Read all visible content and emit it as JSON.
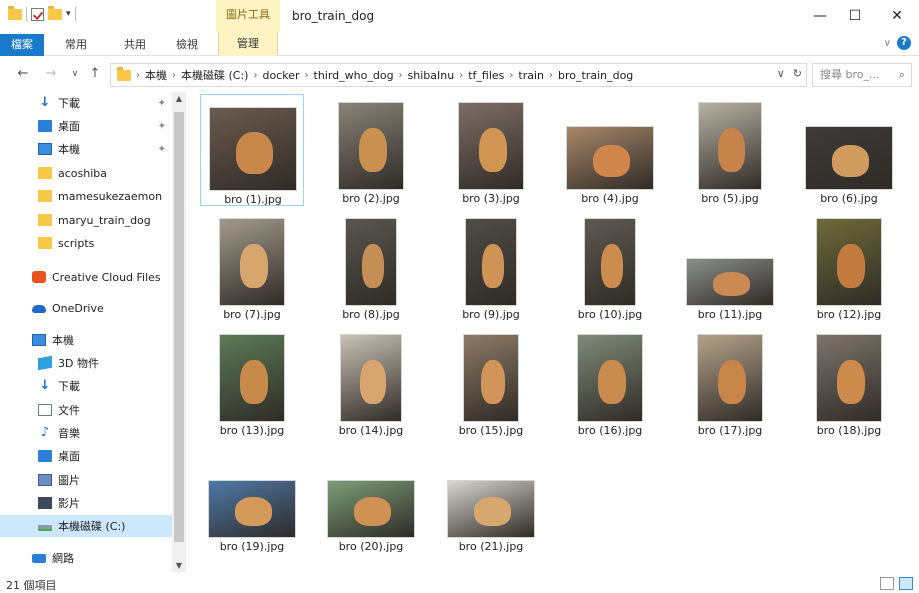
{
  "window": {
    "title": "bro_train_dog",
    "context_tab_group": "圖片工具",
    "minimize": "—",
    "maximize": "☐",
    "close": "✕"
  },
  "ribbon": {
    "tabs": [
      {
        "label": "檔案"
      },
      {
        "label": "常用"
      },
      {
        "label": "共用"
      },
      {
        "label": "檢視"
      },
      {
        "label": "管理"
      }
    ]
  },
  "nav": {
    "back": "←",
    "forward": "→",
    "up": "↑",
    "breadcrumbs": [
      "本機",
      "本機磁碟 (C:)",
      "docker",
      "third_who_dog",
      "shibaInu",
      "tf_files",
      "train",
      "bro_train_dog"
    ],
    "search_placeholder": "搜尋 bro_...",
    "refresh": "↻",
    "dropdown": "∨"
  },
  "sidebar": {
    "items": [
      {
        "label": "下載",
        "icon": "download-icon",
        "pinned": true
      },
      {
        "label": "桌面",
        "icon": "desktop-icon",
        "pinned": true
      },
      {
        "label": "本機",
        "icon": "pc-icon",
        "pinned": true
      },
      {
        "label": "acoshiba",
        "icon": "folder-icon"
      },
      {
        "label": "mamesukezaemon",
        "icon": "folder-icon"
      },
      {
        "label": "maryu_train_dog",
        "icon": "folder-icon"
      },
      {
        "label": "scripts",
        "icon": "folder-icon"
      },
      {
        "label": "Creative Cloud Files",
        "icon": "creative-cloud-icon"
      },
      {
        "label": "OneDrive",
        "icon": "onedrive-icon"
      },
      {
        "label": "本機",
        "icon": "pc-icon"
      },
      {
        "label": "3D 物件",
        "icon": "3d-objects-icon"
      },
      {
        "label": "下載",
        "icon": "download-icon"
      },
      {
        "label": "文件",
        "icon": "documents-icon"
      },
      {
        "label": "音樂",
        "icon": "music-icon"
      },
      {
        "label": "桌面",
        "icon": "desktop-icon"
      },
      {
        "label": "圖片",
        "icon": "pictures-icon"
      },
      {
        "label": "影片",
        "icon": "videos-icon"
      },
      {
        "label": "本機磁碟 (C:)",
        "icon": "drive-icon"
      },
      {
        "label": "網路",
        "icon": "network-icon"
      }
    ]
  },
  "files": [
    {
      "name": "bro (1).jpg",
      "bg": "#6b5a4f",
      "dog": "#c8874a"
    },
    {
      "name": "bro (2).jpg",
      "bg": "#8a8378",
      "dog": "#c9914f"
    },
    {
      "name": "bro (3).jpg",
      "bg": "#7d6e66",
      "dog": "#d19552"
    },
    {
      "name": "bro (4).jpg",
      "bg": "#a7886a",
      "dog": "#d0864a"
    },
    {
      "name": "bro (5).jpg",
      "bg": "#b8b2a4",
      "dog": "#c7834c"
    },
    {
      "name": "bro (6).jpg",
      "bg": "#3c3b38",
      "dog": "#d19a5f"
    },
    {
      "name": "bro (7).jpg",
      "bg": "#a29a8c",
      "dog": "#d6a66c"
    },
    {
      "name": "bro (8).jpg",
      "bg": "#58574f",
      "dog": "#c58e55"
    },
    {
      "name": "bro (9).jpg",
      "bg": "#4f4c46",
      "dog": "#cf9356"
    },
    {
      "name": "bro (10).jpg",
      "bg": "#5e5a52",
      "dog": "#ca8c4f"
    },
    {
      "name": "bro (11).jpg",
      "bg": "#8b8f8a",
      "dog": "#c98a54"
    },
    {
      "name": "bro (12).jpg",
      "bg": "#6d6a3a",
      "dog": "#c27c3f"
    },
    {
      "name": "bro (13).jpg",
      "bg": "#5d7a58",
      "dog": "#c88a4a"
    },
    {
      "name": "bro (14).jpg",
      "bg": "#c9c2b7",
      "dog": "#d8a470"
    },
    {
      "name": "bro (15).jpg",
      "bg": "#8c7a66",
      "dog": "#d19459"
    },
    {
      "name": "bro (16).jpg",
      "bg": "#7f8b79",
      "dog": "#c98b4e"
    },
    {
      "name": "bro (17).jpg",
      "bg": "#b4a38c",
      "dog": "#c7854a"
    },
    {
      "name": "bro (18).jpg",
      "bg": "#7d756c",
      "dog": "#cc8a4b"
    },
    {
      "name": "bro (19).jpg",
      "bg": "#4f79a8",
      "dog": "#d39a5c"
    },
    {
      "name": "bro (20).jpg",
      "bg": "#7d9d78",
      "dog": "#cf9154"
    },
    {
      "name": "bro (21).jpg",
      "bg": "#d8d6d0",
      "dog": "#d6a870"
    }
  ],
  "status": {
    "count": "21 個項目"
  }
}
